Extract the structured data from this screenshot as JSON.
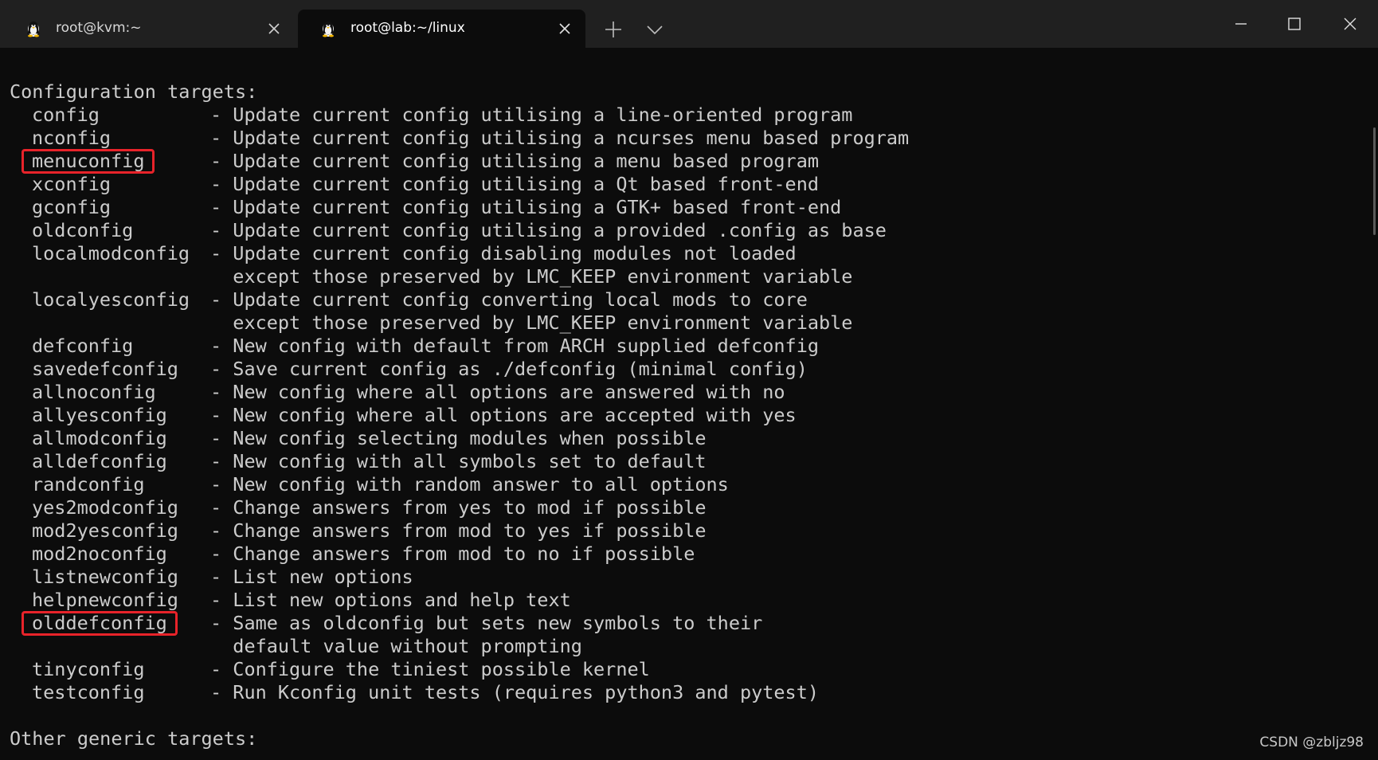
{
  "tabs": [
    {
      "title": "root@kvm:~",
      "active": false
    },
    {
      "title": "root@lab:~/linux",
      "active": true
    }
  ],
  "icons": {
    "tab_icon": "tux-penguin-icon",
    "close": "close-icon",
    "new_tab": "plus-icon",
    "dropdown": "chevron-down-icon",
    "minimize": "minimize-icon",
    "maximize": "maximize-icon",
    "window_close": "close-icon"
  },
  "colors": {
    "terminal_bg": "#0c0c0c",
    "terminal_fg": "#cccccc",
    "titlebar_bg": "#202020",
    "highlight": "#e8232a"
  },
  "terminal": {
    "section_config": "Configuration targets:",
    "rows": [
      {
        "target": "config",
        "desc": "- Update current config utilising a line-oriented program"
      },
      {
        "target": "nconfig",
        "desc": "- Update current config utilising a ncurses menu based program"
      },
      {
        "target": "menuconfig",
        "desc": "- Update current config utilising a menu based program",
        "highlighted": true
      },
      {
        "target": "xconfig",
        "desc": "- Update current config utilising a Qt based front-end"
      },
      {
        "target": "gconfig",
        "desc": "- Update current config utilising a GTK+ based front-end"
      },
      {
        "target": "oldconfig",
        "desc": "- Update current config utilising a provided .config as base"
      },
      {
        "target": "localmodconfig",
        "desc": "- Update current config disabling modules not loaded"
      },
      {
        "target": "",
        "desc": "  except those preserved by LMC_KEEP environment variable"
      },
      {
        "target": "localyesconfig",
        "desc": "- Update current config converting local mods to core"
      },
      {
        "target": "",
        "desc": "  except those preserved by LMC_KEEP environment variable"
      },
      {
        "target": "defconfig",
        "desc": "- New config with default from ARCH supplied defconfig"
      },
      {
        "target": "savedefconfig",
        "desc": "- Save current config as ./defconfig (minimal config)"
      },
      {
        "target": "allnoconfig",
        "desc": "- New config where all options are answered with no"
      },
      {
        "target": "allyesconfig",
        "desc": "- New config where all options are accepted with yes"
      },
      {
        "target": "allmodconfig",
        "desc": "- New config selecting modules when possible"
      },
      {
        "target": "alldefconfig",
        "desc": "- New config with all symbols set to default"
      },
      {
        "target": "randconfig",
        "desc": "- New config with random answer to all options"
      },
      {
        "target": "yes2modconfig",
        "desc": "- Change answers from yes to mod if possible"
      },
      {
        "target": "mod2yesconfig",
        "desc": "- Change answers from mod to yes if possible"
      },
      {
        "target": "mod2noconfig",
        "desc": "- Change answers from mod to no if possible"
      },
      {
        "target": "listnewconfig",
        "desc": "- List new options"
      },
      {
        "target": "helpnewconfig",
        "desc": "- List new options and help text"
      },
      {
        "target": "olddefconfig",
        "desc": "- Same as oldconfig but sets new symbols to their",
        "highlighted": true
      },
      {
        "target": "",
        "desc": "  default value without prompting"
      },
      {
        "target": "tinyconfig",
        "desc": "- Configure the tiniest possible kernel"
      },
      {
        "target": "testconfig",
        "desc": "- Run Kconfig unit tests (requires python3 and pytest)"
      }
    ],
    "section_other": "Other generic targets:"
  },
  "watermark": "CSDN @zbljz98"
}
